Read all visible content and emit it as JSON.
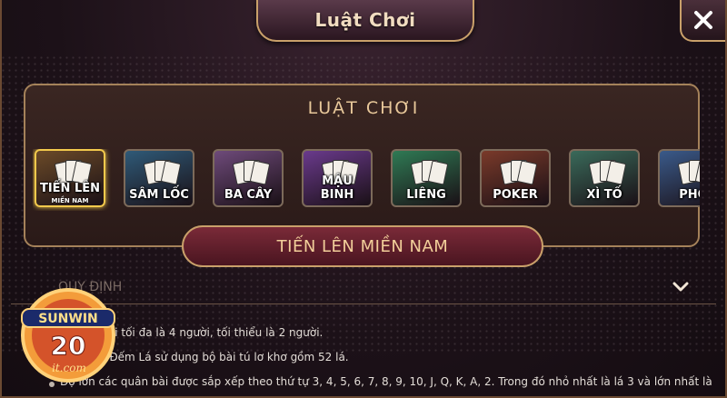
{
  "window": {
    "title": "Luật Chơi"
  },
  "close_icon": "close-icon",
  "panel": {
    "title": "LUẬT CHƠI"
  },
  "games": [
    {
      "label": "TIẾN LÊN",
      "sub": "MIỀN NAM",
      "color": "#6b4a28",
      "active": true
    },
    {
      "label": "SÂM LỐC",
      "sub": "",
      "color": "#2f5a78",
      "active": false
    },
    {
      "label": "BA CÂY",
      "sub": "",
      "color": "#6e4a7a",
      "active": false
    },
    {
      "label": "MẬU BINH",
      "sub": "",
      "color": "#6a3a8c",
      "active": false
    },
    {
      "label": "LIÊNG",
      "sub": "",
      "color": "#2f7a54",
      "active": false
    },
    {
      "label": "POKER",
      "sub": "",
      "color": "#7a3a2a",
      "active": false
    },
    {
      "label": "XÌ TỐ",
      "sub": "",
      "color": "#3a6a5a",
      "active": false
    },
    {
      "label": "PHỎ",
      "sub": "",
      "color": "#3a5a8a",
      "active": false
    }
  ],
  "selected_game": "TIẾN LÊN MIỀN NAM",
  "section": {
    "title": "QUY ĐỊNH",
    "chevron": "chevron-down-icon"
  },
  "rules": [
    "Người chơi tối đa là 4 người, tối thiểu là 2 người.",
    "Tiến Lên Đếm Lá sử dụng bộ bài tú lơ khơ gồm 52 lá.",
    "Độ lớn các quân bài được sắp xếp theo thứ tự 3, 4, 5, 6, 7, 8, 9, 10, J, Q, K, A, 2. Trong đó nhỏ nhất là lá 3 và lớn nhất là"
  ],
  "logo": {
    "brand": "SUNWIN",
    "number": "20",
    "domain": "it.com"
  },
  "colors": {
    "gold": "#c9a06a",
    "accent": "#f2cf9a",
    "selected_bar": "#7a2a38"
  }
}
